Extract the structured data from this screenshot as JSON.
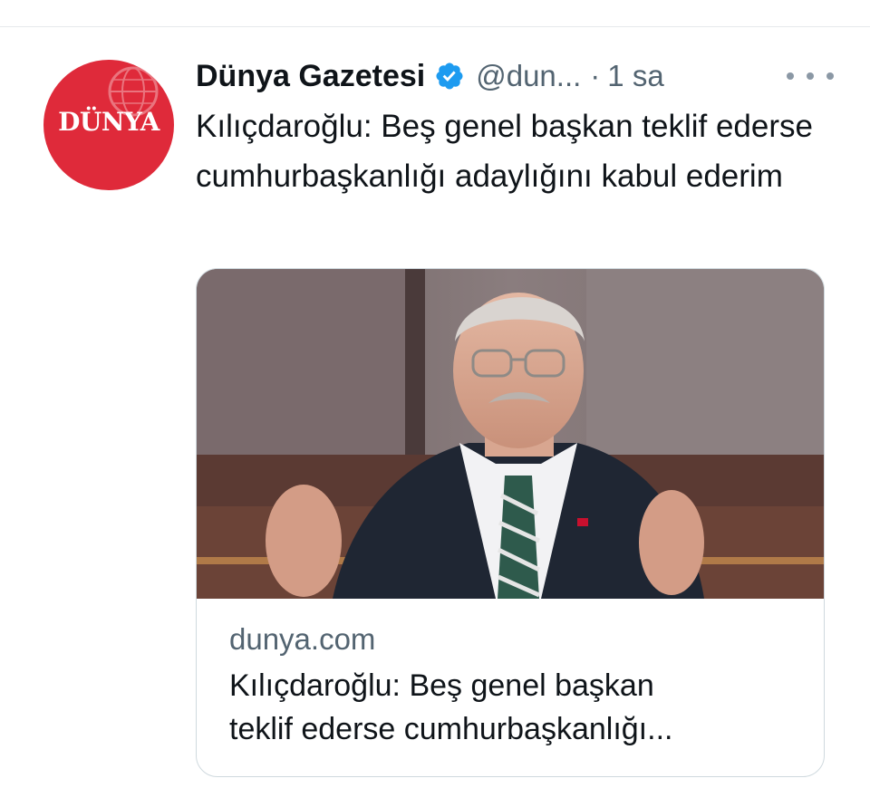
{
  "tweet": {
    "author": {
      "name": "Dünya Gazetesi",
      "handle": "@dun...",
      "avatar_text": "DÜNYA",
      "verified": true,
      "avatar_color": "#df2a3a",
      "verified_color": "#1d9bf0"
    },
    "separator": "·",
    "time": "1 sa",
    "more_icon": "ellipsis-icon",
    "text": "Kılıçdaroğlu: Beş genel başkan teklif ederse cumhurbaşkanlığı adaylığını kabul ederim",
    "card": {
      "domain": "dunya.com",
      "title_line1": "Kılıçdaroğlu: Beş genel başkan",
      "title_line2": "teklif ederse cumhurbaşkanlığı..."
    }
  },
  "colors": {
    "text_primary": "#0f1419",
    "text_secondary": "#536471",
    "border": "#cfd9de"
  }
}
